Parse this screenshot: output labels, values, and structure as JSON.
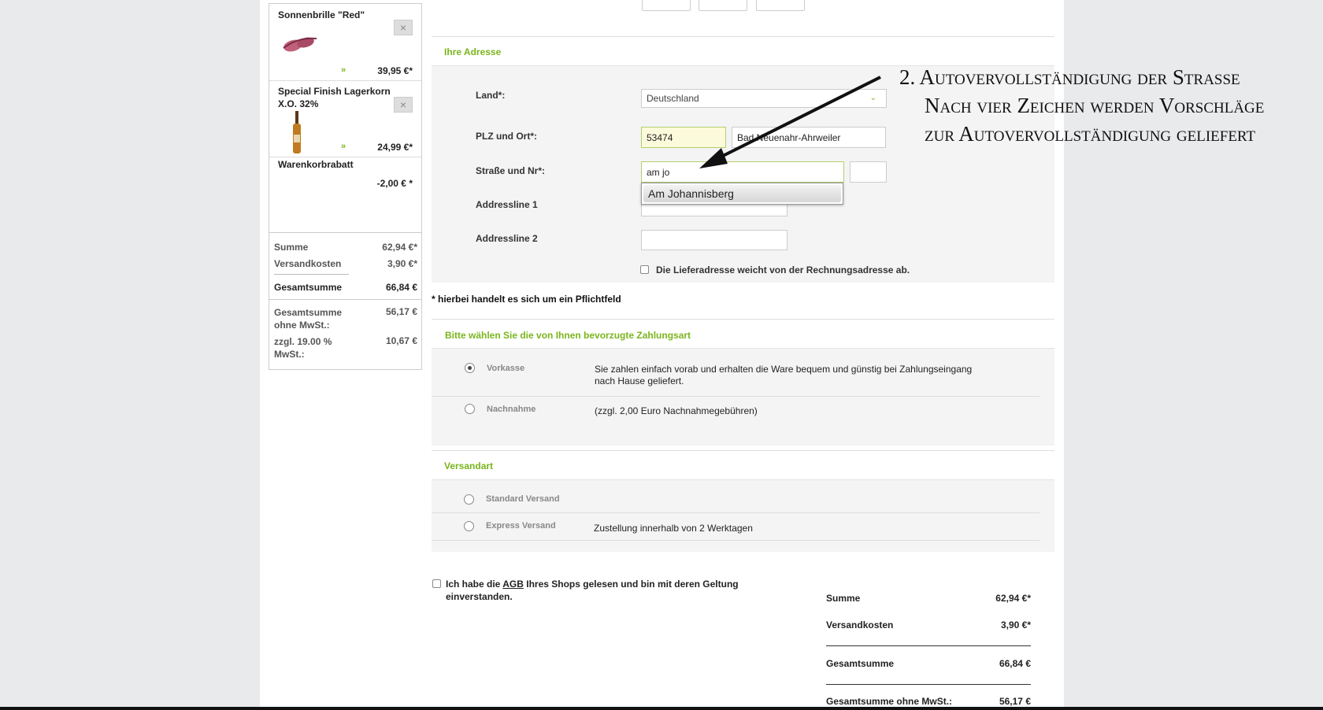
{
  "cart": {
    "items": [
      {
        "name": "Sonnenbrille \"Red\"",
        "price": "39,95 €*",
        "remove": "×"
      },
      {
        "name": "Special Finish Lagerkorn X.O. 32%",
        "price": "24,99 €*",
        "remove": "×"
      },
      {
        "name": "Warenkorbrabatt",
        "price": "-2,00 € *"
      }
    ],
    "summary": {
      "summe_label": "Summe",
      "summe": "62,94 €*",
      "versand_label": "Versandkosten",
      "versand": "3,90 €*",
      "gesamt_label": "Gesamtsumme",
      "gesamt": "66,84 €",
      "netto_label": "Gesamtsumme ohne MwSt.:",
      "netto": "56,17 €",
      "mwst_label": "zzgl. 19.00 % MwSt.:",
      "mwst": "10,67 €"
    }
  },
  "address": {
    "title": "Ihre Adresse",
    "land_label": "Land*:",
    "land_value": "Deutschland",
    "plz_label": "PLZ und Ort*:",
    "plz_value": "53474",
    "ort_value": "Bad Neuenahr-Ahrweiler",
    "strasse_label": "Straße und Nr*:",
    "strasse_value": "am jo",
    "nr_value": "",
    "suggestion": "Am Johannisberg",
    "addr1_label": "Addressline 1",
    "addr2_label": "Addressline 2",
    "liefer_label": "Die Lieferadresse weicht von der Rechnungsadresse ab."
  },
  "pflicht_note": "* hierbei handelt es sich um ein Pflichtfeld",
  "payment": {
    "title": "Bitte wählen Sie die von Ihnen bevorzugte Zahlungsart",
    "options": [
      {
        "name": "Vorkasse",
        "desc": "Sie zahlen einfach vorab und erhalten die Ware bequem und günstig bei Zahlungseingang nach Hause geliefert.",
        "selected": true
      },
      {
        "name": "Nachnahme",
        "desc": "(zzgl. 2,00 Euro Nachnahmegebühren)",
        "selected": false
      }
    ]
  },
  "shipping": {
    "title": "Versandart",
    "options": [
      {
        "name": "Standard Versand",
        "desc": ""
      },
      {
        "name": "Express Versand",
        "desc": "Zustellung innerhalb von 2 Werktagen"
      }
    ]
  },
  "agb": {
    "pre": "Ich habe die ",
    "link": "AGB",
    "post": " Ihres Shops gelesen und bin mit deren Geltung einverstanden."
  },
  "totals": {
    "summe_label": "Summe",
    "summe": "62,94 €*",
    "versand_label": "Versandkosten",
    "versand": "3,90 €*",
    "gesamt_label": "Gesamtsumme",
    "gesamt": "66,84 €",
    "netto_label": "Gesamtsumme ohne MwSt.:",
    "netto": "56,17 €"
  },
  "annotation": {
    "line1": "2. Autovervollständigung der Straße",
    "line2": "Nach vier Zeichen werden Vorschläge",
    "line3": "zur Autovervollständigung geliefert"
  },
  "colors": {
    "accent": "#7ab51d",
    "page_bg": "#e9eaec"
  }
}
